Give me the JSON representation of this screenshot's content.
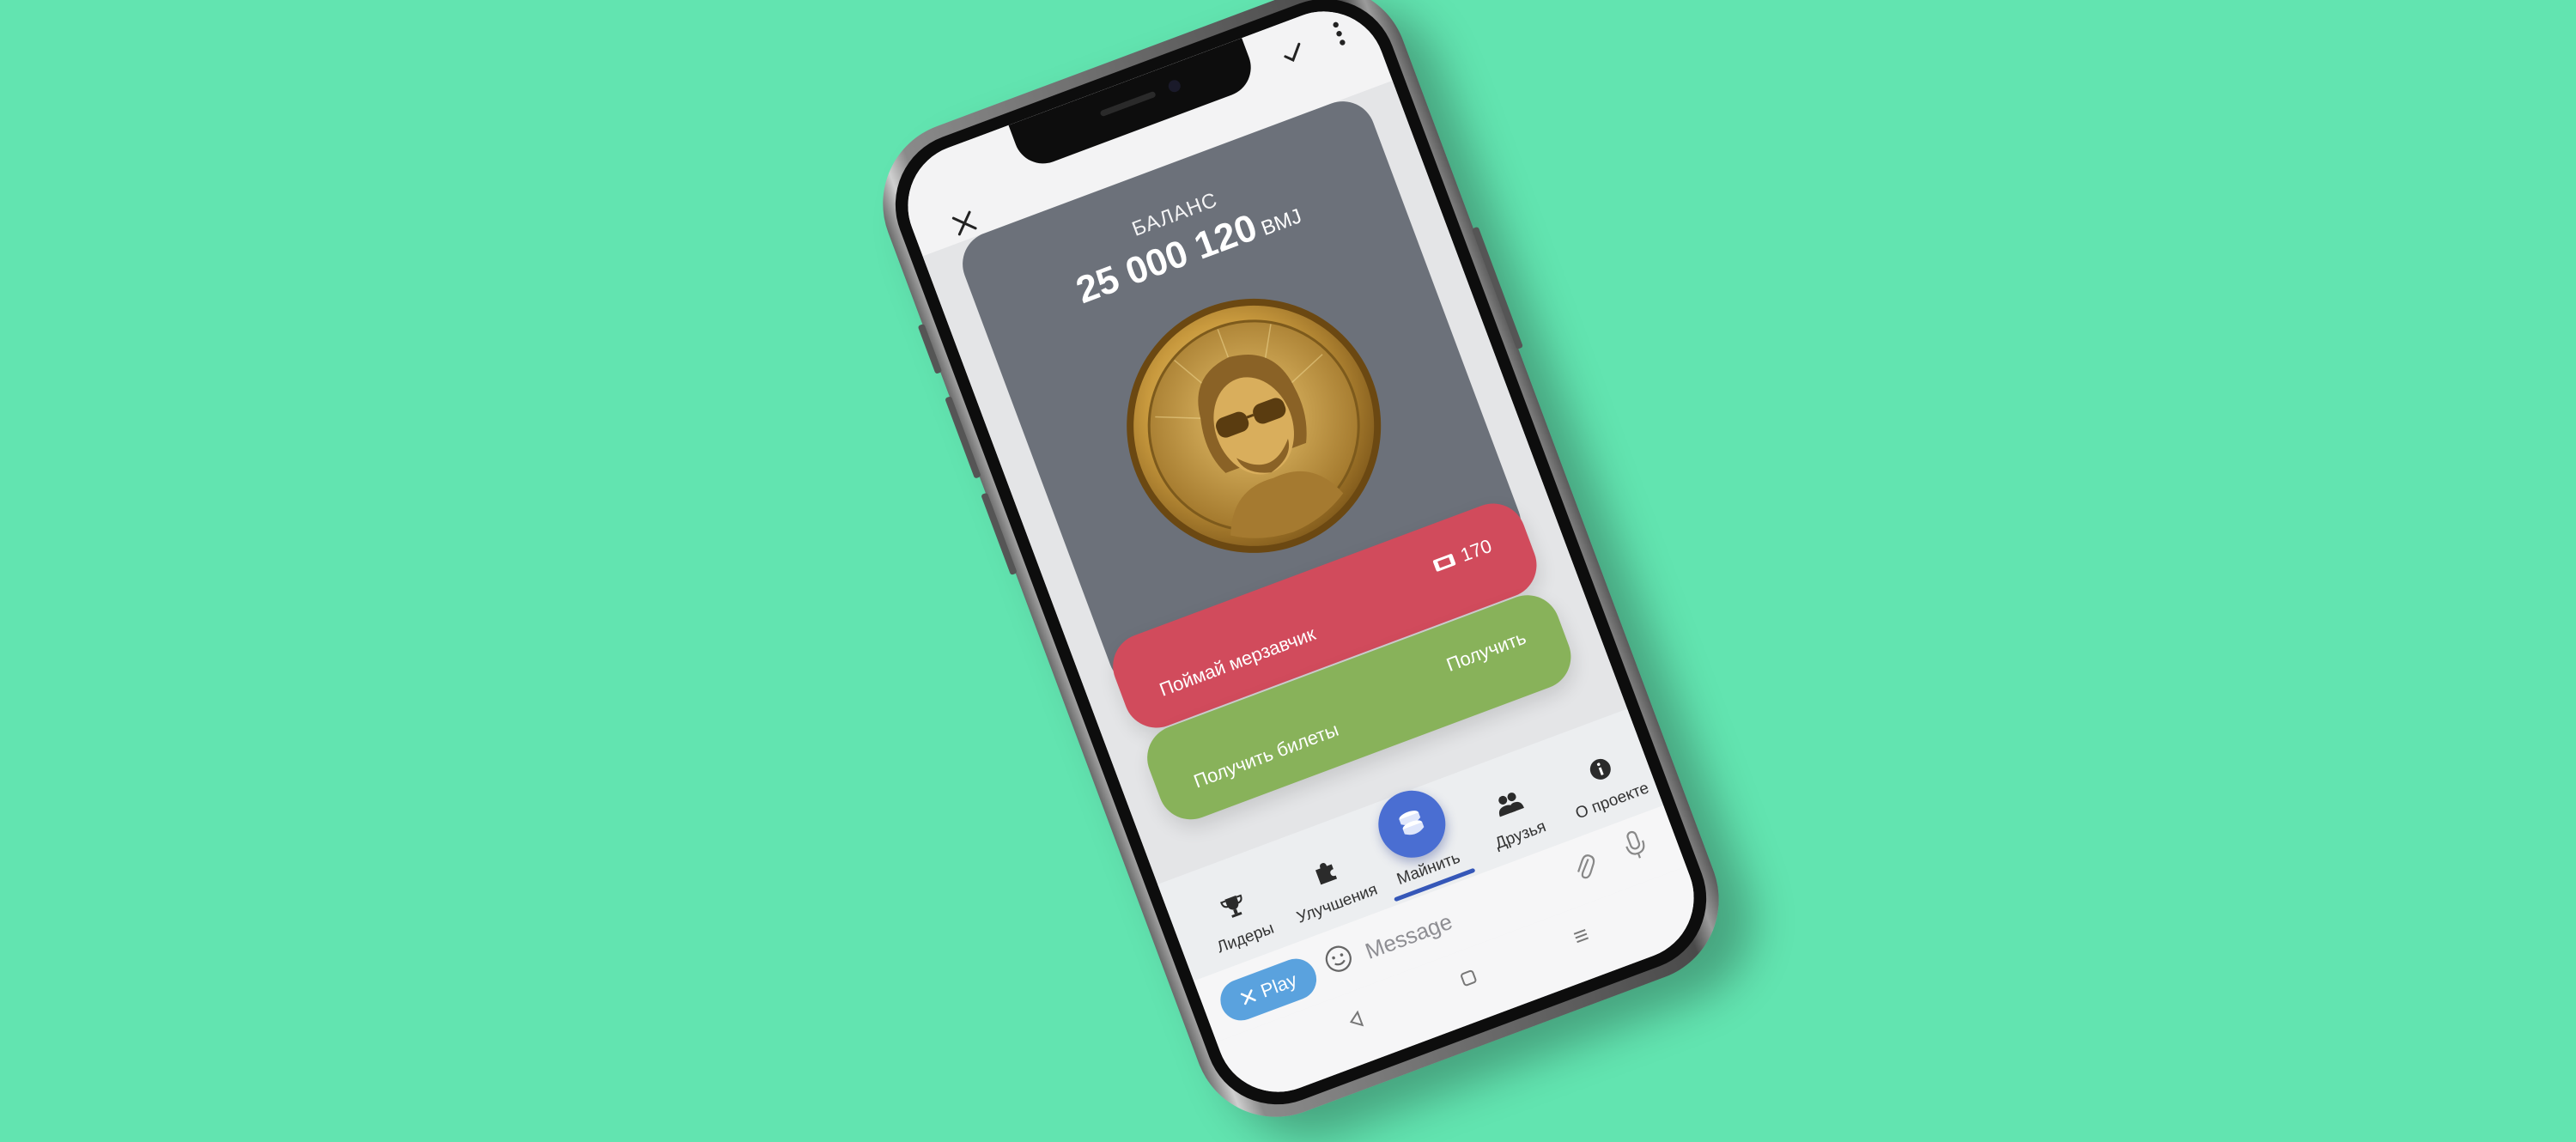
{
  "colors": {
    "background": "#62e4b0",
    "card_gray": "#6c717a",
    "catch_red": "#d14b5c",
    "tickets_green": "#88b25a",
    "mine_blue": "#4a6ed2",
    "play_blue": "#5aa2de"
  },
  "topbar": {
    "close_icon": "close-icon",
    "check_icon": "check-icon",
    "menu_icon": "more-vertical-icon"
  },
  "balance": {
    "label": "БАЛАНС",
    "amount": "25 000 120",
    "unit": "BMJ",
    "image": "gold-coin-portrait"
  },
  "catch_card": {
    "title": "Поймай мерзавчик",
    "ticket_icon": "ticket-icon",
    "ticket_count": "170"
  },
  "tickets_card": {
    "title": "Получить билеты",
    "action": "Получить"
  },
  "nav": {
    "items": [
      {
        "label": "Лидеры",
        "icon": "trophy-icon"
      },
      {
        "label": "Улучшения",
        "icon": "puzzle-icon"
      },
      {
        "label": "Майнить",
        "icon": "coins-icon",
        "active": true
      },
      {
        "label": "Друзья",
        "icon": "friends-icon"
      },
      {
        "label": "О проекте",
        "icon": "info-icon"
      }
    ]
  },
  "message_bar": {
    "play_label": "Play",
    "placeholder": "Message"
  }
}
